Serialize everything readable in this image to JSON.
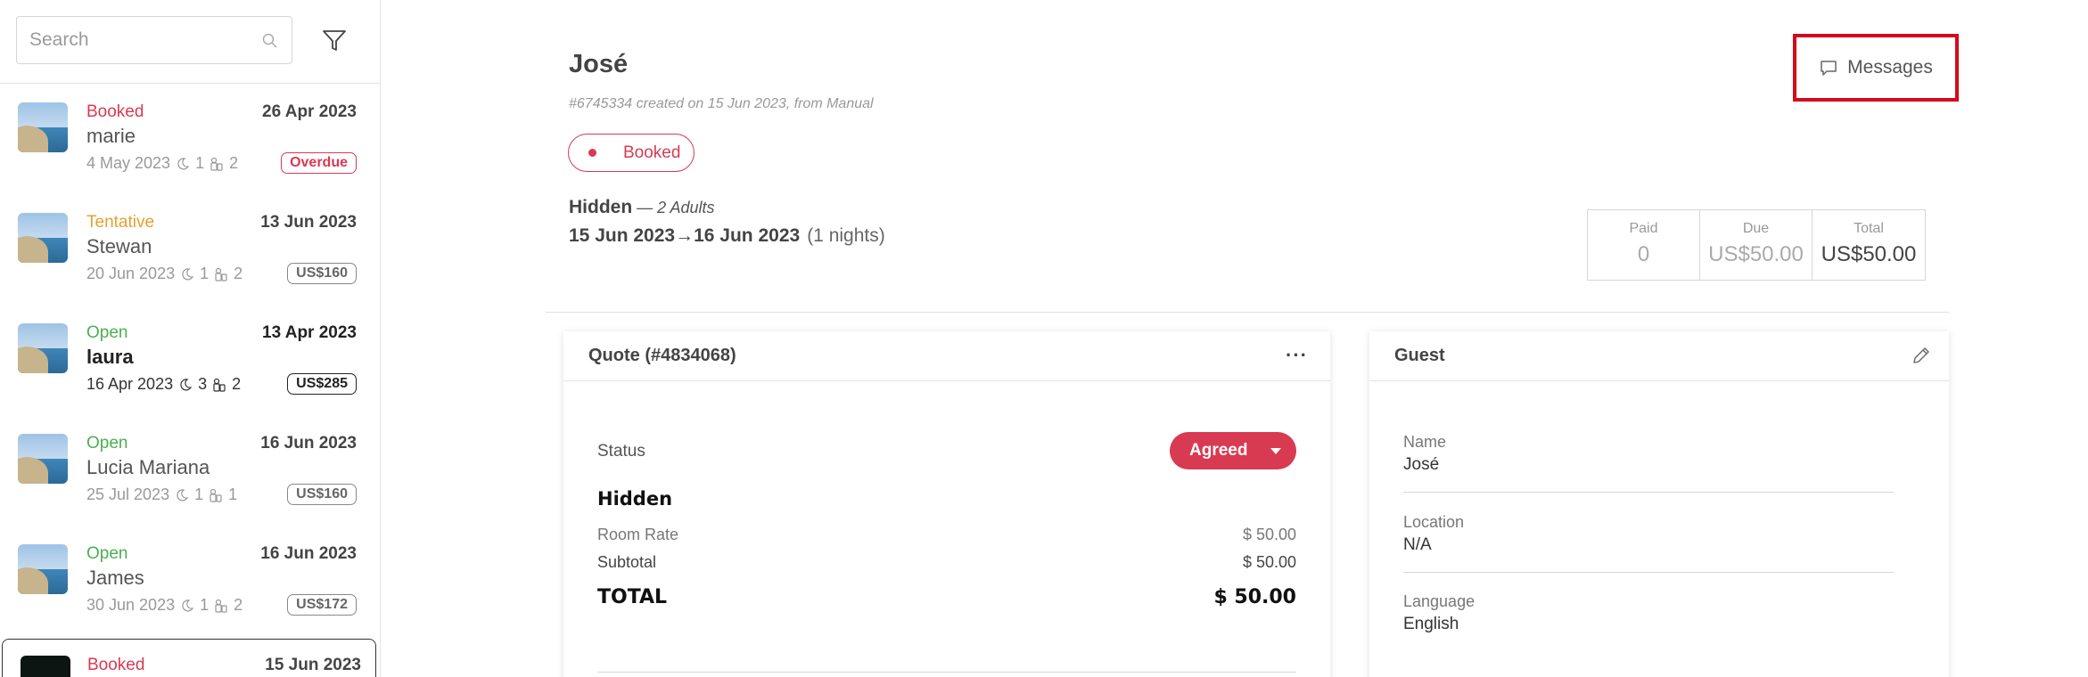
{
  "sidebar": {
    "search_placeholder": "Search",
    "items": [
      {
        "status": "Booked",
        "status_class": "booked",
        "date": "26 Apr 2023",
        "name": "marie",
        "checkin": "4 May 2023",
        "nights": "1",
        "guests": "2",
        "badge": "Overdue"
      },
      {
        "status": "Tentative",
        "status_class": "tentative",
        "date": "13 Jun 2023",
        "name": "Stewan",
        "checkin": "20 Jun 2023",
        "nights": "1",
        "guests": "2",
        "badge": "US$160"
      },
      {
        "status": "Open",
        "status_class": "open",
        "date": "13 Apr 2023",
        "name": "laura",
        "checkin": "16 Apr 2023",
        "nights": "3",
        "guests": "2",
        "badge": "US$285"
      },
      {
        "status": "Open",
        "status_class": "open",
        "date": "16 Jun 2023",
        "name": "Lucia Mariana",
        "checkin": "25 Jul 2023",
        "nights": "1",
        "guests": "1",
        "badge": "US$160"
      },
      {
        "status": "Open",
        "status_class": "open",
        "date": "16 Jun 2023",
        "name": "James",
        "checkin": "30 Jun 2023",
        "nights": "1",
        "guests": "2",
        "badge": "US$172"
      },
      {
        "status": "Booked",
        "status_class": "booked",
        "date": "15 Jun 2023"
      }
    ]
  },
  "header": {
    "title": "José",
    "subtitle": "#6745334 created on 15 Jun 2023, from Manual",
    "status": "Booked",
    "messages_label": "Messages"
  },
  "stay": {
    "room": "Hidden",
    "adults": " — 2 Adults",
    "checkin": "15 Jun 2023",
    "arrow": "→",
    "checkout": "16 Jun 2023",
    "nights": "(1 nights)"
  },
  "totals": [
    {
      "label": "Paid",
      "value": "0"
    },
    {
      "label": "Due",
      "value": "US$50.00"
    },
    {
      "label": "Total",
      "value": "US$50.00"
    }
  ],
  "quote": {
    "title": "Quote (#4834068)",
    "menu": "···",
    "status_label": "Status",
    "status_value": "Agreed",
    "room": "Hidden",
    "rows": [
      {
        "label": "Room Rate",
        "value": "$ 50.00"
      },
      {
        "label": "Subtotal",
        "value": "$ 50.00"
      }
    ],
    "total_label": "TOTAL",
    "total_value": "$ 50.00"
  },
  "guest": {
    "title": "Guest",
    "fields": [
      {
        "label": "Name",
        "value": "José"
      },
      {
        "label": "Location",
        "value": "N/A"
      },
      {
        "label": "Language",
        "value": "English"
      }
    ]
  },
  "colors": {
    "booked": "#d83a52",
    "tentative": "#e6a02f",
    "open": "#4caf50",
    "highlight_border": "#d4091b"
  },
  "icons": [
    "search-icon",
    "filter-icon",
    "moon-icon",
    "guests-icon",
    "chat-icon",
    "pencil-icon"
  ]
}
